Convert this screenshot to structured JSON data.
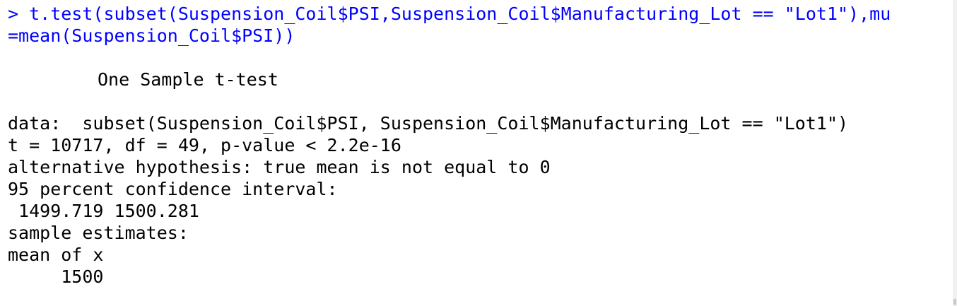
{
  "console": {
    "command_line_1": "> t.test(subset(Suspension_Coil$PSI,Suspension_Coil$Manufacturing_Lot == \"Lot1\"),mu",
    "command_line_2": "=mean(Suspension_Coil$PSI))",
    "test_title": "One Sample t-test",
    "data_line": "data:  subset(Suspension_Coil$PSI, Suspension_Coil$Manufacturing_Lot == \"Lot1\")",
    "stat_line": "t = 10717, df = 49, p-value < 2.2e-16",
    "alt_hypothesis": "alternative hypothesis: true mean is not equal to 0",
    "ci_label": "95 percent confidence interval:",
    "ci_values": " 1499.719 1500.281",
    "estimates_label": "sample estimates:",
    "estimate_name": "mean of x",
    "estimate_value": "     1500"
  },
  "colors": {
    "command": "#0000ff",
    "output": "#000000",
    "background": "#ffffff"
  }
}
